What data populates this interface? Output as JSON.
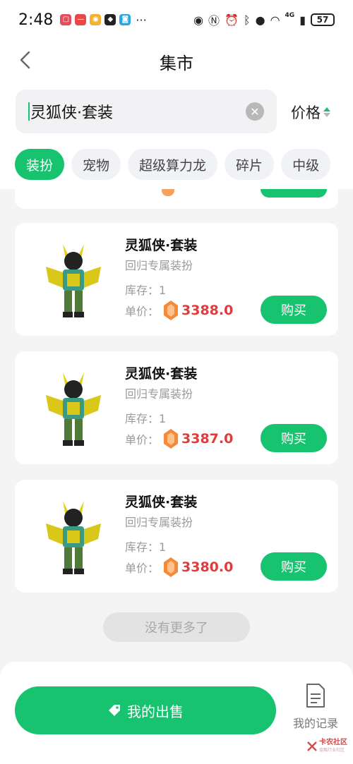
{
  "status_bar": {
    "time": "2:48",
    "network": "4G",
    "battery": "57"
  },
  "header": {
    "title": "集市"
  },
  "search": {
    "value": "灵狐侠·套装",
    "sort_label": "价格"
  },
  "categories": [
    "装扮",
    "宠物",
    "超级算力龙",
    "碎片",
    "中级"
  ],
  "products": [
    {
      "name": "灵狐侠·套装",
      "subtitle": "回归专属装扮",
      "stock": "库存：1",
      "price_label": "单价：",
      "price": "3388.0",
      "buy_label": "购买"
    },
    {
      "name": "灵狐侠·套装",
      "subtitle": "回归专属装扮",
      "stock": "库存：1",
      "price_label": "单价：",
      "price": "3387.0",
      "buy_label": "购买"
    },
    {
      "name": "灵狐侠·套装",
      "subtitle": "回归专属装扮",
      "stock": "库存：1",
      "price_label": "单价：",
      "price": "3380.0",
      "buy_label": "购买"
    }
  ],
  "no_more": "没有更多了",
  "bottom": {
    "sell_label": "我的出售",
    "record_label": "我的记录"
  },
  "watermark": {
    "text": "卡农社区",
    "subtext": "金融行业社区"
  },
  "colors": {
    "accent": "#17c36f",
    "price": "#e23b3b"
  }
}
